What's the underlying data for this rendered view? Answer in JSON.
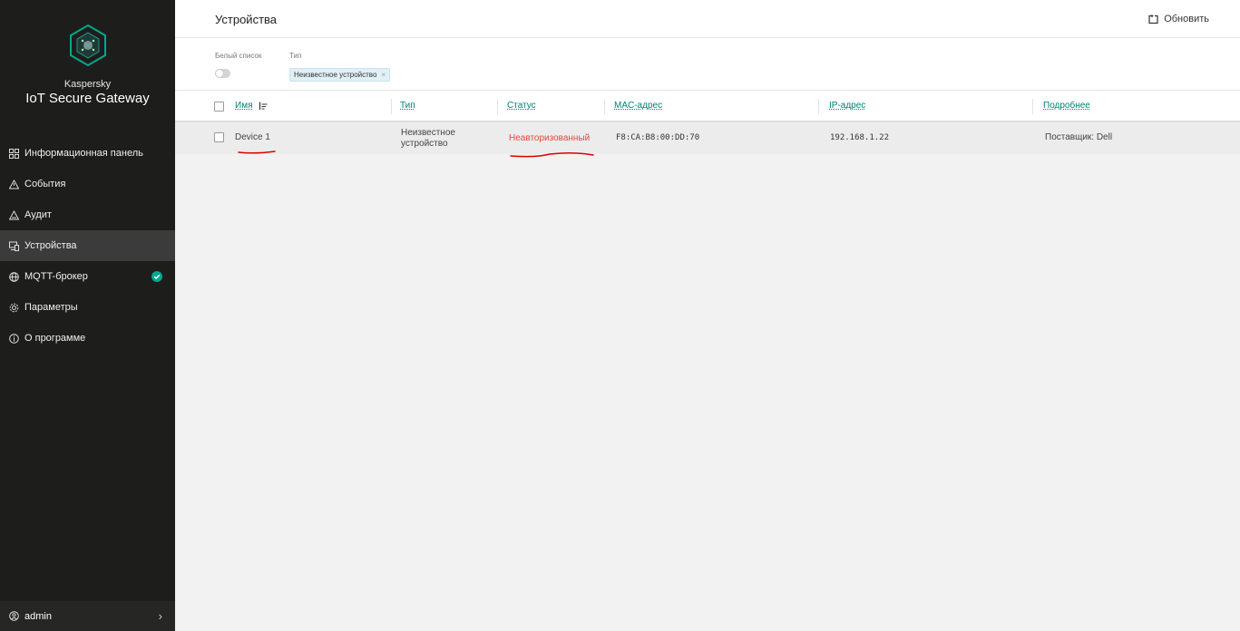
{
  "brand": {
    "vendor": "Kaspersky",
    "product": "IoT Secure Gateway"
  },
  "colors": {
    "sidebar_bg": "#1d1d1b",
    "accent": "#008272",
    "status_unauthorized": "#e34b3c",
    "badge_ok": "#00a88e"
  },
  "sidebar": {
    "items": [
      {
        "label": "Информационная панель",
        "icon": "dashboard-icon"
      },
      {
        "label": "События",
        "icon": "warning-triangle-icon"
      },
      {
        "label": "Аудит",
        "icon": "audit-triangle-icon"
      },
      {
        "label": "Устройства",
        "icon": "devices-icon",
        "active": true
      },
      {
        "label": "MQTT-брокер",
        "icon": "globe-icon",
        "badge": "check-badge-icon"
      },
      {
        "label": "Параметры",
        "icon": "gear-icon"
      },
      {
        "label": "О программе",
        "icon": "info-icon"
      }
    ],
    "user": {
      "name": "admin",
      "icon": "user-icon"
    }
  },
  "header": {
    "title": "Устройства",
    "refresh_label": "Обновить"
  },
  "filters": {
    "whitelist_label": "Белый список",
    "type_label": "Тип",
    "type_chip": "Неизвестное устройство"
  },
  "table": {
    "columns": [
      "Имя",
      "Тип",
      "Статус",
      "MAC-адрес",
      "IP-адрес",
      "Подробнее"
    ],
    "rows": [
      {
        "name": "Device 1",
        "type_line1": "Неизвестное",
        "type_line2": "устройство",
        "status": "Неавторизованный",
        "mac": "F8:CA:B8:00:DD:70",
        "ip": "192.168.1.22",
        "details": "Поставщик: Dell"
      }
    ]
  }
}
